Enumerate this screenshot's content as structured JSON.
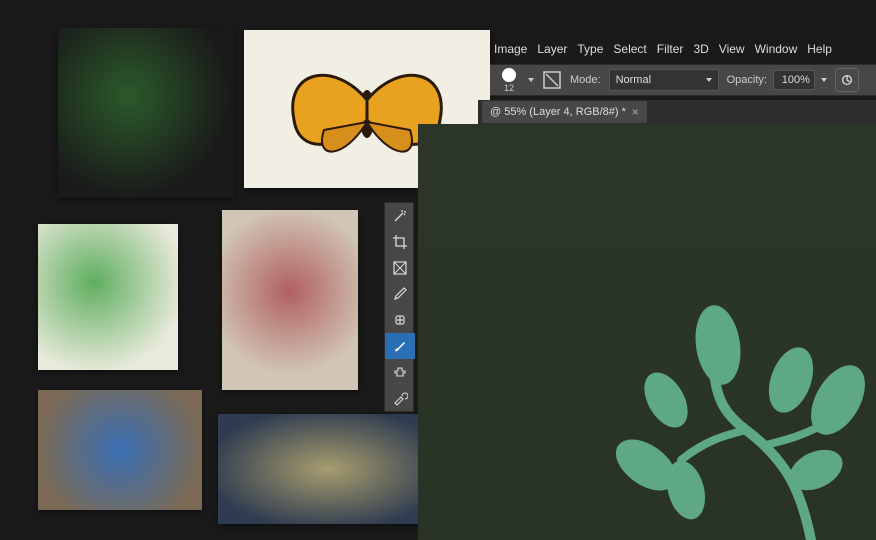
{
  "menu": {
    "image": "Image",
    "layer": "Layer",
    "type": "Type",
    "select": "Select",
    "filter": "Filter",
    "threeD": "3D",
    "view": "View",
    "window": "Window",
    "help": "Help"
  },
  "options": {
    "brush_size": "12",
    "mode_label": "Mode:",
    "mode_value": "Normal",
    "opacity_label": "Opacity:",
    "opacity_value": "100%"
  },
  "document": {
    "tab_label": "@ 55% (Layer 4, RGB/8#) *"
  },
  "tools": {
    "magic_wand": "magic-wand",
    "crop": "crop",
    "frame": "frame",
    "eyedropper": "eyedropper",
    "healing_brush": "healing-brush",
    "brush": "brush",
    "stamp": "stamp",
    "history_brush": "history-brush"
  }
}
